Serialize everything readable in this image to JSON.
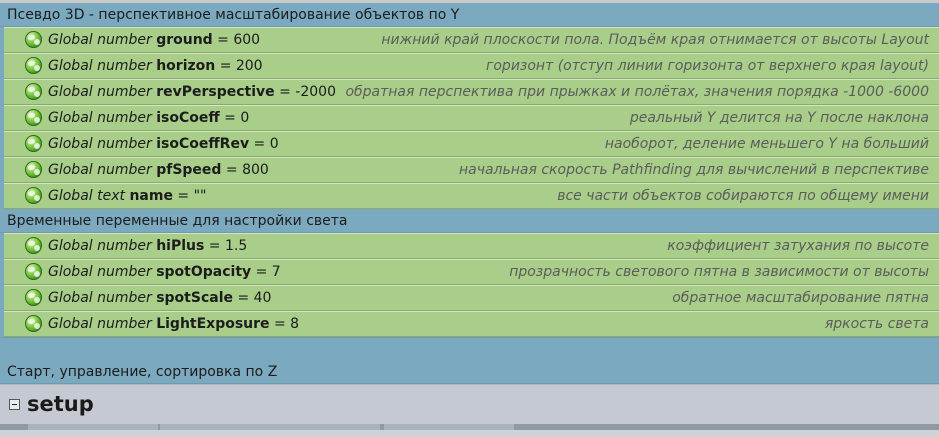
{
  "groups": [
    {
      "title": "Псевдо 3D - перспективное масштабирование объектов по Y",
      "variables": [
        {
          "kind": "Global number",
          "name": "ground",
          "value": "= 600",
          "comment": "нижний край плоскости пола. Подъём края отнимается от высоты Layout"
        },
        {
          "kind": "Global number",
          "name": "horizon",
          "value": "= 200",
          "comment": "горизонт (отступ линии горизонта от верхнего края layout)"
        },
        {
          "kind": "Global number",
          "name": "revPerspective",
          "value": "= -2000",
          "comment": "обратная перспектива при прыжках и полётах, значения порядка -1000 -6000"
        },
        {
          "kind": "Global number",
          "name": "isoCoeff",
          "value": "= 0",
          "comment": "реальный Y делится на Y после наклона"
        },
        {
          "kind": "Global number",
          "name": "isoCoeffRev",
          "value": "= 0",
          "comment": "наоборот, деление меньшего Y на больший"
        },
        {
          "kind": "Global number",
          "name": "pfSpeed",
          "value": "= 800",
          "comment": "начальная скорость Pathfinding для вычислений в перспективе"
        },
        {
          "kind": "Global text",
          "name": "name",
          "value": "= \"\"",
          "comment": "все части объектов собираются по общему имени"
        }
      ]
    },
    {
      "title": "Временные переменные для настройки света",
      "variables": [
        {
          "kind": "Global number",
          "name": "hiPlus",
          "value": "= 1.5",
          "comment": "коэффициент затухания по высоте"
        },
        {
          "kind": "Global number",
          "name": "spotOpacity",
          "value": "= 7",
          "comment": "прозрачность светового пятна в зависимости от высоты"
        },
        {
          "kind": "Global number",
          "name": "spotScale",
          "value": "= 40",
          "comment": "обратное масштабирование пятна"
        },
        {
          "kind": "Global number",
          "name": "LightExposure",
          "value": "= 8",
          "comment": "яркость света"
        }
      ]
    },
    {
      "title": "Старт, управление, сортировка по Z",
      "variables": []
    }
  ],
  "setup": {
    "title": "setup"
  },
  "icons": {
    "variable": "globe-icon",
    "collapse": "collapse-minus-icon"
  },
  "colors": {
    "group_header": "#7ba9bf",
    "variable_row": "#a8ce8a",
    "setup_bar": "#c5c9d1",
    "comment_text": "#5c5c5c"
  }
}
